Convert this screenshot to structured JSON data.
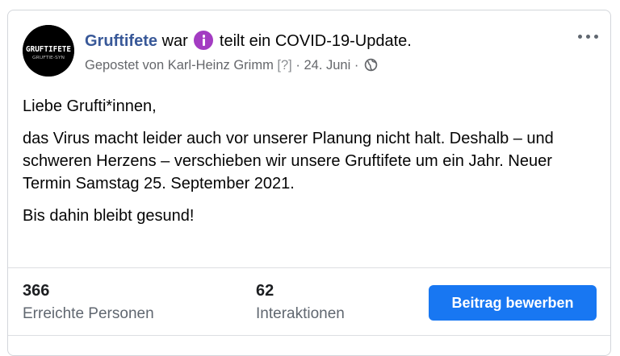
{
  "post": {
    "page_name": "Gruftifete",
    "action_pre": "war",
    "action_post": "teilt ein COVID-19-Update.",
    "posted_by": "Gepostet von Karl-Heinz Grimm",
    "unknown_marker": "[?]",
    "separator": "·",
    "date": "24. Juni",
    "avatar_text_main": "GRUFTIFETE",
    "avatar_text_sub": "GRUFTIE-SYN",
    "paragraphs": [
      "Liebe Grufti*innen,",
      "das Virus macht leider auch vor unserer Planung nicht halt. Deshalb – und schweren Herzens – verschieben wir unsere Gruftifete um ein Jahr. Neuer Termin Samstag 25. September 2021.",
      "Bis dahin bleibt gesund!"
    ]
  },
  "stats": {
    "reach_value": "366",
    "reach_label": "Erreichte Personen",
    "interactions_value": "62",
    "interactions_label": "Interaktionen"
  },
  "actions": {
    "promote_label": "Beitrag bewerben"
  },
  "icons": {
    "info": "info-icon",
    "audience": "globe-icon",
    "more": "more-options-icon"
  },
  "colors": {
    "page_name": "#385898",
    "info_badge": "#a33cc2",
    "button": "#1877f2",
    "secondary_text": "#65676b"
  }
}
